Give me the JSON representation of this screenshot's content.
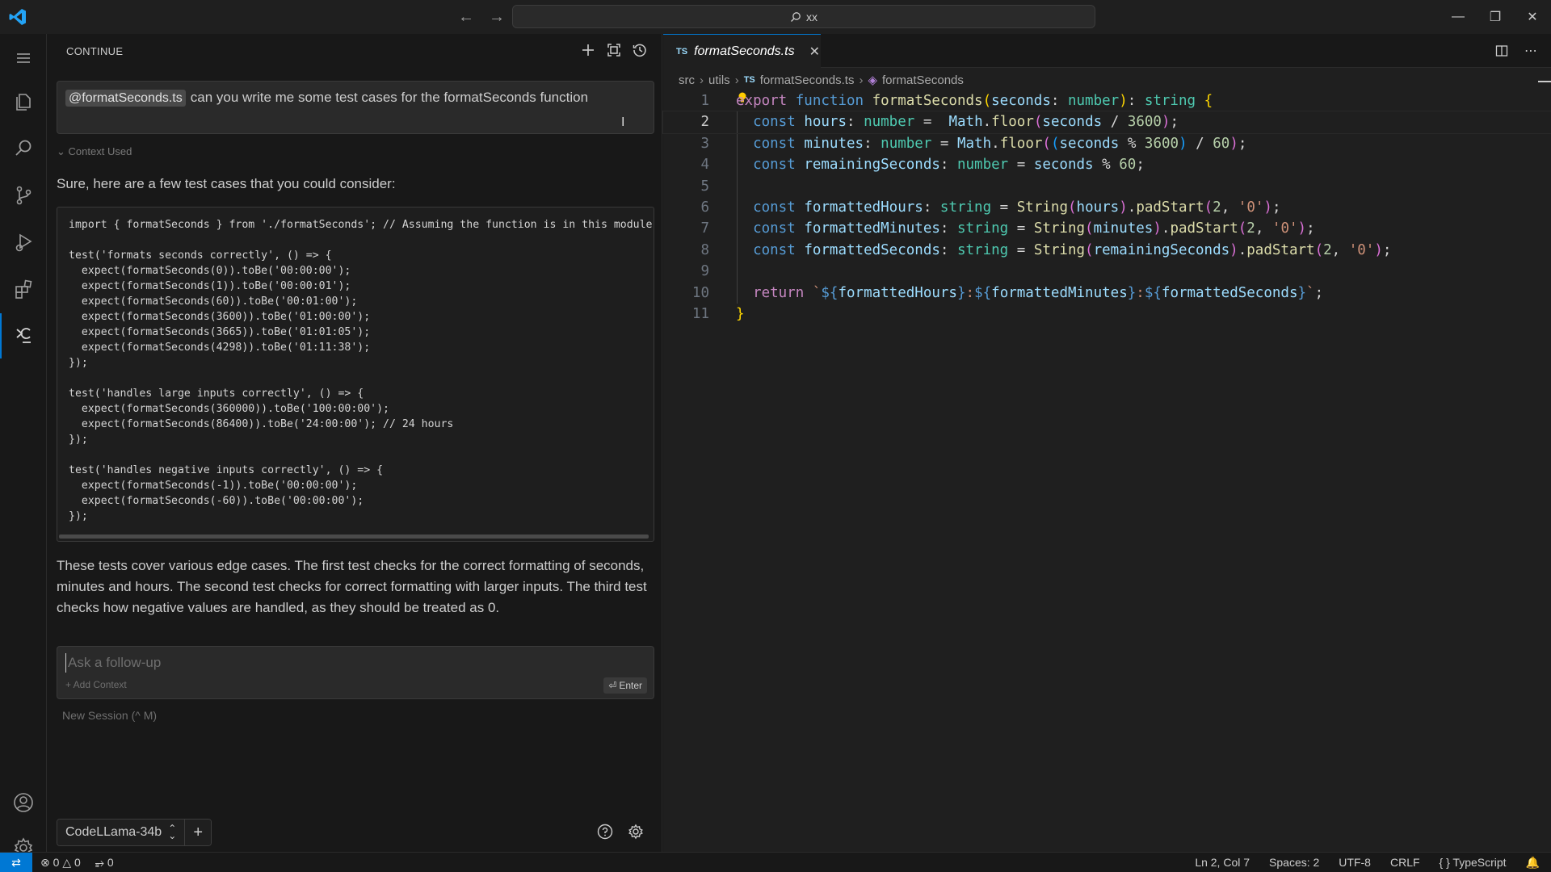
{
  "window": {
    "search_text": "xx"
  },
  "sidebar": {
    "title": "CONTINUE",
    "user_message": {
      "mention": "@formatSeconds.ts",
      "text": "can you write me some test cases for the formatSeconds function"
    },
    "context_used": "Context Used",
    "answer_intro": "Sure, here are a few test cases that you could consider:",
    "answer_code": "import { formatSeconds } from './formatSeconds'; // Assuming the function is in this module\n\ntest('formats seconds correctly', () => {\n  expect(formatSeconds(0)).toBe('00:00:00');\n  expect(formatSeconds(1)).toBe('00:00:01');\n  expect(formatSeconds(60)).toBe('00:01:00');\n  expect(formatSeconds(3600)).toBe('01:00:00');\n  expect(formatSeconds(3665)).toBe('01:01:05');\n  expect(formatSeconds(4298)).toBe('01:11:38');\n});\n\ntest('handles large inputs correctly', () => {\n  expect(formatSeconds(360000)).toBe('100:00:00');\n  expect(formatSeconds(86400)).toBe('24:00:00'); // 24 hours\n});\n\ntest('handles negative inputs correctly', () => {\n  expect(formatSeconds(-1)).toBe('00:00:00');\n  expect(formatSeconds(-60)).toBe('00:00:00');\n});",
    "answer_outro": "These tests cover various edge cases. The first test checks for the correct formatting of seconds, minutes and hours. The second test checks for correct formatting with larger inputs. The third test checks how negative values are handled, as they should be treated as 0.",
    "followup_placeholder": "Ask a follow-up",
    "add_context": "+ Add Context",
    "enter_label": "Enter",
    "new_session": "New Session (^ M)",
    "model": "CodeLLama-34b"
  },
  "editor": {
    "tab_label": "formatSeconds.ts",
    "tab_lang_badge": "TS",
    "breadcrumbs": [
      "src",
      "utils",
      "formatSeconds.ts",
      "formatSeconds"
    ],
    "line_numbers": [
      "1",
      "2",
      "3",
      "4",
      "5",
      "6",
      "7",
      "8",
      "9",
      "10",
      "11"
    ],
    "active_line": "2"
  },
  "statusbar": {
    "errors": "0",
    "warnings": "0",
    "ports": "0",
    "cursor": "Ln 2, Col 7",
    "spaces": "Spaces: 2",
    "encoding": "UTF-8",
    "eol": "CRLF",
    "language": "TypeScript"
  },
  "colors": {
    "accent": "#0078d4",
    "background": "#181818",
    "editor_background": "#1f1f1f"
  },
  "icons": {
    "activity": [
      "explorer-icon",
      "search-icon",
      "source-control-icon",
      "run-debug-icon",
      "extensions-icon",
      "continue-icon",
      "account-icon",
      "manage-gear-icon"
    ]
  }
}
